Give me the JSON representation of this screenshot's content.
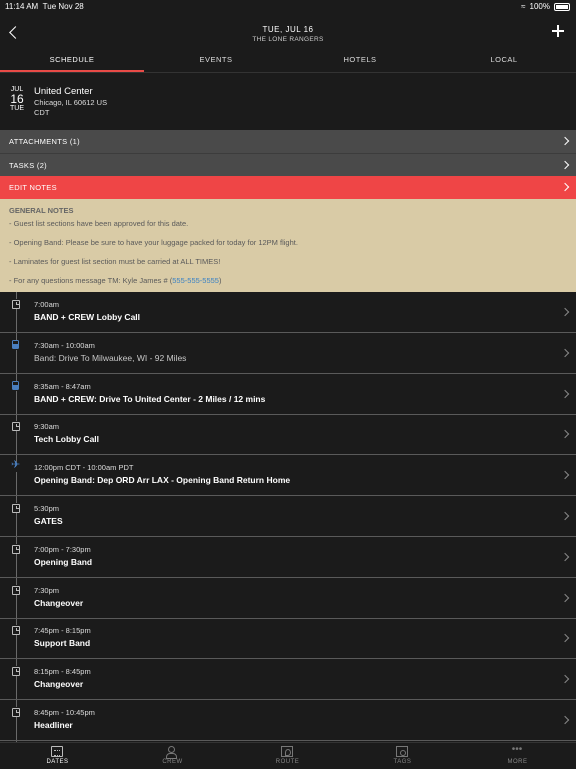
{
  "status_bar": {
    "time": "11:14 AM",
    "date": "Tue Nov 28",
    "battery": "100%"
  },
  "header": {
    "date_title": "TUE, JUL 16",
    "subtitle": "THE LONE RANGERS"
  },
  "tabs": [
    {
      "label": "SCHEDULE",
      "active": true
    },
    {
      "label": "EVENTS",
      "active": false
    },
    {
      "label": "HOTELS",
      "active": false
    },
    {
      "label": "LOCAL",
      "active": false
    }
  ],
  "venue": {
    "month": "JUL",
    "day": "16",
    "weekday": "TUE",
    "name": "United Center",
    "address": "Chicago, IL 60612 US",
    "timezone": "CDT"
  },
  "rows": {
    "attachments": "ATTACHMENTS (1)",
    "tasks": "TASKS (2)",
    "edit_notes": "EDIT NOTES"
  },
  "notes": {
    "heading": "GENERAL NOTES",
    "lines": [
      "- Guest list sections have been approved for this date.",
      "- Opening Band: Please be sure to have your luggage packed for today for 12PM flight.",
      "- Laminates for guest list section must be carried at ALL TIMES!"
    ],
    "contact_prefix": "-  For any questions message TM: Kyle James # (",
    "contact_phone": "555-555-5555",
    "contact_suffix": ")"
  },
  "events": [
    {
      "icon": "clock-icon",
      "time": "7:00am",
      "title": "BAND + CREW Lobby Call",
      "dim": false
    },
    {
      "icon": "bus-icon",
      "time": "7:30am - 10:00am",
      "title": "Band: Drive To Milwaukee, WI - 92 Miles",
      "dim": true
    },
    {
      "icon": "bus-icon",
      "time": "8:35am - 8:47am",
      "title": "BAND + CREW: Drive To United Center - 2 Miles / 12 mins",
      "dim": false
    },
    {
      "icon": "clock-icon",
      "time": "9:30am",
      "title": "Tech Lobby Call",
      "dim": false
    },
    {
      "icon": "plane-icon",
      "time": "12:00pm CDT - 10:00am PDT",
      "title": "Opening Band: Dep ORD Arr LAX - Opening Band Return Home",
      "dim": false
    },
    {
      "icon": "clock-icon",
      "time": "5:30pm",
      "title": "GATES",
      "dim": false
    },
    {
      "icon": "clock-icon",
      "time": "7:00pm - 7:30pm",
      "title": "Opening Band",
      "dim": false
    },
    {
      "icon": "clock-icon",
      "time": "7:30pm",
      "title": "Changeover",
      "dim": false
    },
    {
      "icon": "clock-icon",
      "time": "7:45pm - 8:15pm",
      "title": "Support Band",
      "dim": false
    },
    {
      "icon": "clock-icon",
      "time": "8:15pm - 8:45pm",
      "title": "Changeover",
      "dim": false
    },
    {
      "icon": "clock-icon",
      "time": "8:45pm - 10:45pm",
      "title": "Headliner",
      "dim": false
    }
  ],
  "bottom_nav": [
    {
      "label": "DATES",
      "icon": "calendar-icon",
      "active": true
    },
    {
      "label": "CREW",
      "icon": "crew-icon",
      "active": false
    },
    {
      "label": "ROUTE",
      "icon": "route-icon",
      "active": false
    },
    {
      "label": "TAGS",
      "icon": "tags-icon",
      "active": false
    },
    {
      "label": "MORE",
      "icon": "more-icon",
      "active": false
    }
  ],
  "colors": {
    "accent": "#ef4546",
    "notes_bg": "#d9cba6",
    "link": "#3b82c4",
    "transport_icon": "#4a7fc0"
  }
}
